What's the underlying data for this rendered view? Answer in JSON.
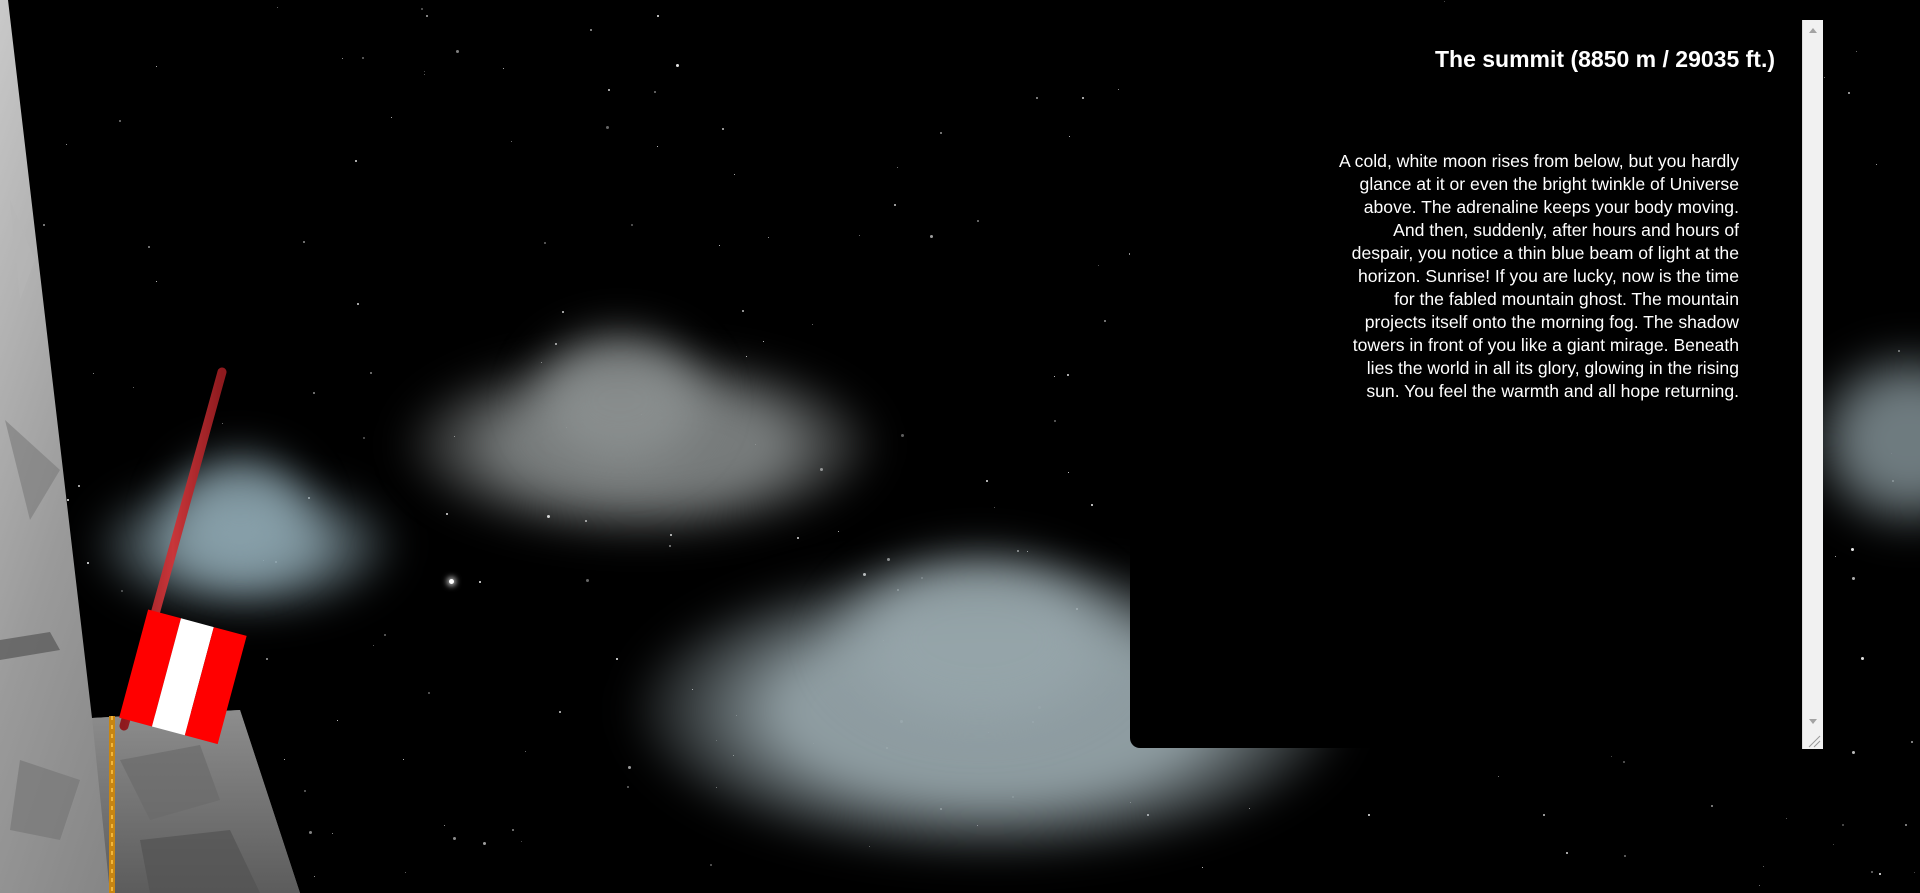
{
  "summit_panel": {
    "title": "The summit (8850 m / 29035 ft.)",
    "body": "A cold, white moon rises from below, but you hardly glance at it or even the bright twinkle of Universe above. The adrenaline keeps your body moving. And then, suddenly, after hours and hours of despair, you notice a thin blue beam of light at the horizon. Sunrise! If you are lucky, now is the time for the fabled mountain ghost. The mountain projects itself onto the morning fog. The shadow towers in front of you like a giant mirage. Beneath lies the world in all its glory, glowing in the rising sun. You feel the warmth and all hope returning."
  },
  "scrollbar": {
    "up_icon": "triangle-up",
    "down_icon": "triangle-down",
    "grip_icon": "resize-grip"
  },
  "scene": {
    "background_color": "#000000",
    "flag_colors": [
      "#ff0000",
      "#ffffff",
      "#ff0000"
    ],
    "pole_color": "#b8262a",
    "rope_color": "#d99a1e",
    "rock_color": "#8a8a8a",
    "cloud_color": "#8c9ba1"
  }
}
